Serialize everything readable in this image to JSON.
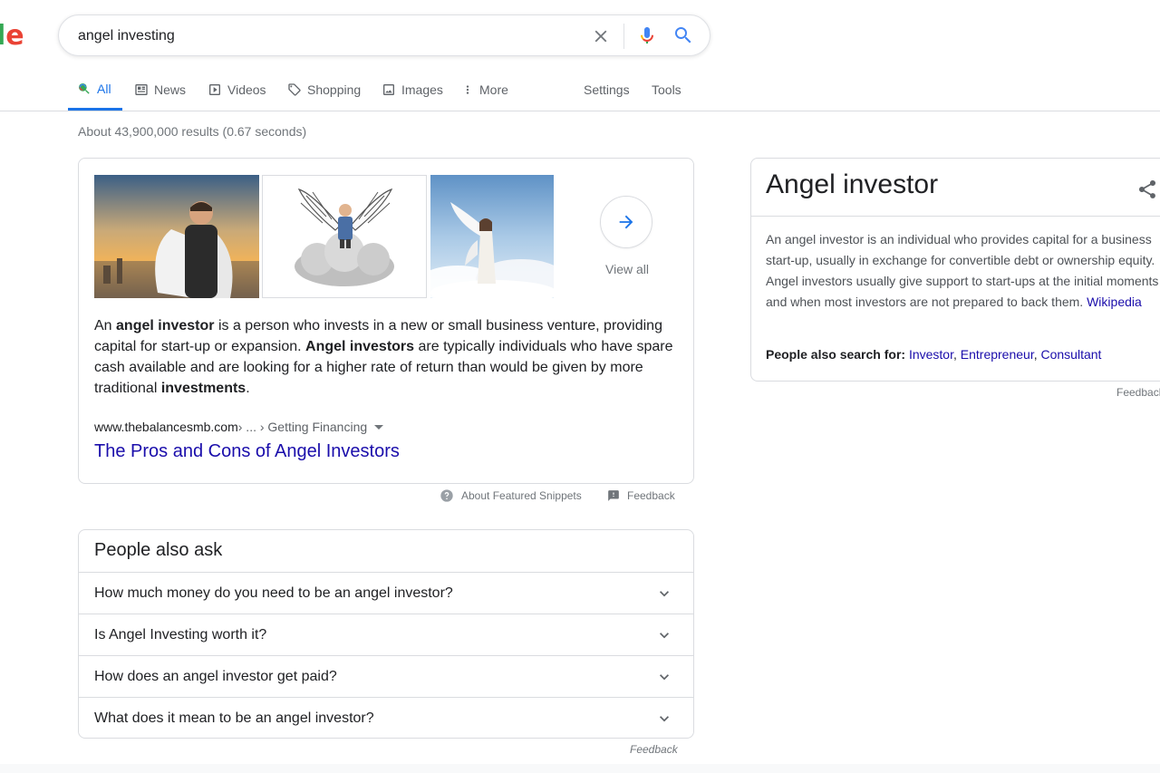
{
  "logo": {
    "letter_l": "l",
    "letter_e": "e"
  },
  "search": {
    "query": "angel investing"
  },
  "tabs": [
    {
      "label": "All"
    },
    {
      "label": "News"
    },
    {
      "label": "Videos"
    },
    {
      "label": "Shopping"
    },
    {
      "label": "Images"
    },
    {
      "label": "More"
    }
  ],
  "tools": {
    "settings": "Settings",
    "tools": "Tools"
  },
  "stats": "About 43,900,000 results (0.67 seconds)",
  "featured": {
    "view_all": "View all",
    "snippet": {
      "p1": "An ",
      "b1": "angel investor",
      "p2": " is a person who invests in a new or small business venture, providing capital for start-up or expansion. ",
      "b2": "Angel investors",
      "p3": " are typically individuals who have spare cash available and are looking for a higher rate of return than would be given by more traditional ",
      "b3": "investments",
      "p4": "."
    },
    "cite_domain": "www.thebalancesmb.com",
    "cite_path": " › ... › Getting Financing",
    "title": "The Pros and Cons of Angel Investors",
    "about_label": "About Featured Snippets",
    "feedback_label": "Feedback"
  },
  "paa": {
    "title": "People also ask",
    "questions": [
      "How much money do you need to be an angel investor?",
      "Is Angel Investing worth it?",
      "How does an angel investor get paid?",
      "What does it mean to be an angel investor?"
    ],
    "feedback": "Feedback"
  },
  "knowledge_panel": {
    "title": "Angel investor",
    "description": "An angel investor is an individual who provides capital for a business start-up, usually in exchange for convertible debt or ownership equity. Angel investors usually give support to start-ups at the initial moments and when most investors are not prepared to back them. ",
    "source": "Wikipedia",
    "also_label": "People also search for: ",
    "also_items": [
      "Investor",
      "Entrepreneur",
      "Consultant"
    ],
    "separator": ", ",
    "feedback": "Feedback"
  },
  "colors": {
    "accent": "#1a73e8",
    "link": "#1a0dab",
    "border": "#dadce0",
    "muted": "#70757a"
  }
}
